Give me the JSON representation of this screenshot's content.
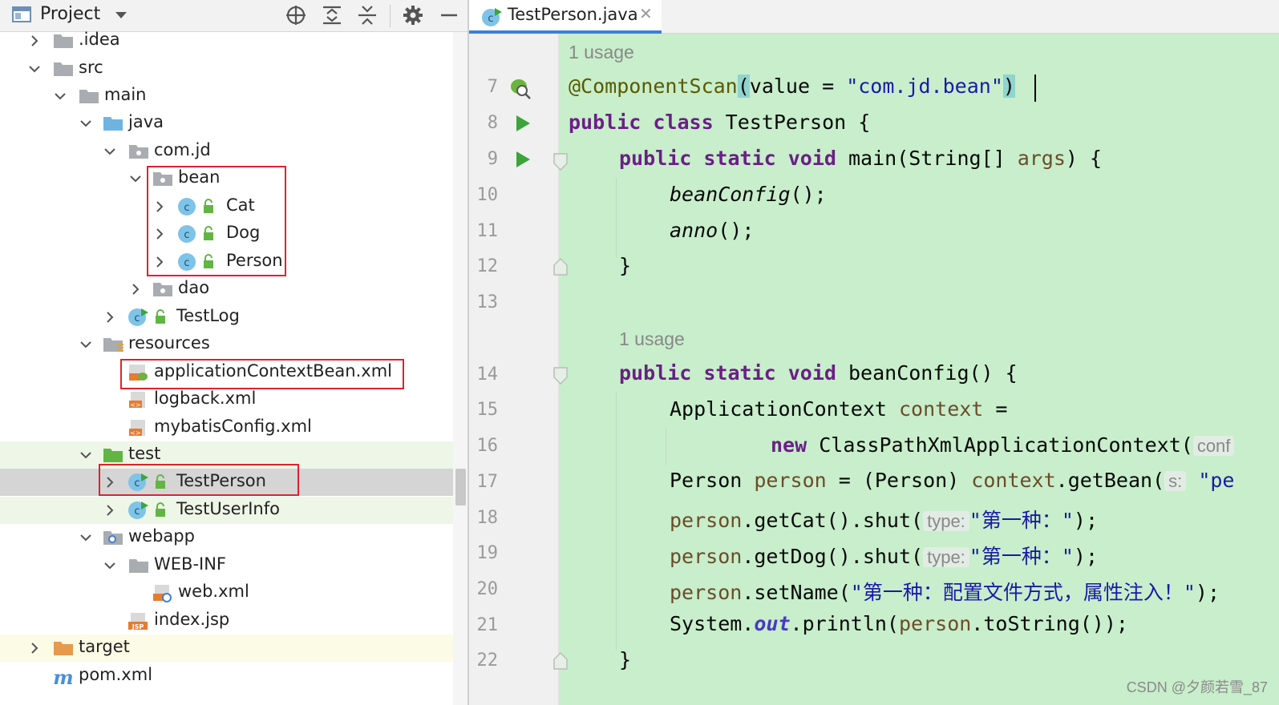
{
  "project_panel": {
    "title": "Project",
    "toolbar_icons": [
      "locate-icon",
      "expand-all-icon",
      "collapse-all-icon",
      "settings-icon",
      "minimize-icon"
    ],
    "tree": [
      {
        "label": ".idea",
        "icon": "folder-icon",
        "expanded": false
      },
      {
        "label": "src",
        "icon": "folder-icon",
        "expanded": true
      },
      {
        "label": "main",
        "icon": "folder-icon",
        "expanded": true
      },
      {
        "label": "java",
        "icon": "source-folder-icon",
        "expanded": true
      },
      {
        "label": "com.jd",
        "icon": "package-icon",
        "expanded": true
      },
      {
        "label": "bean",
        "icon": "package-icon",
        "expanded": true
      },
      {
        "label": "Cat",
        "icon": "class-icon",
        "expanded": false
      },
      {
        "label": "Dog",
        "icon": "class-icon",
        "expanded": false
      },
      {
        "label": "Person",
        "icon": "class-icon",
        "expanded": false
      },
      {
        "label": "dao",
        "icon": "package-icon",
        "expanded": false
      },
      {
        "label": "TestLog",
        "icon": "test-class-icon",
        "expanded": false
      },
      {
        "label": "resources",
        "icon": "resources-folder-icon",
        "expanded": true
      },
      {
        "label": "applicationContextBean.xml",
        "icon": "spring-xml-icon"
      },
      {
        "label": "logback.xml",
        "icon": "xml-file-icon"
      },
      {
        "label": "mybatisConfig.xml",
        "icon": "xml-file-icon"
      },
      {
        "label": "test",
        "icon": "test-folder-icon",
        "expanded": true
      },
      {
        "label": "TestPerson",
        "icon": "test-class-icon",
        "expanded": false,
        "selected": true
      },
      {
        "label": "TestUserInfo",
        "icon": "test-class-icon",
        "expanded": false
      },
      {
        "label": "webapp",
        "icon": "web-folder-icon",
        "expanded": true
      },
      {
        "label": "WEB-INF",
        "icon": "folder-icon",
        "expanded": true
      },
      {
        "label": "web.xml",
        "icon": "web-xml-icon"
      },
      {
        "label": "index.jsp",
        "icon": "jsp-file-icon"
      },
      {
        "label": "target",
        "icon": "excluded-folder-icon",
        "expanded": false
      },
      {
        "label": "pom.xml",
        "icon": "maven-icon"
      }
    ]
  },
  "editor": {
    "tab": {
      "label": "TestPerson.java",
      "close": "✕"
    },
    "usage_hints": [
      "1 usage",
      "1 usage"
    ],
    "line_numbers": [
      "7",
      "8",
      "9",
      "10",
      "11",
      "12",
      "13",
      "14",
      "15",
      "16",
      "17",
      "18",
      "19",
      "20",
      "21",
      "22"
    ],
    "lines": {
      "l7": {
        "ann": "@ComponentScan",
        "p1": "(",
        "attr": "value = ",
        "str": "\"com.jd.bean\"",
        "p2": ")"
      },
      "l8": {
        "kw": "public class ",
        "rest": "TestPerson {"
      },
      "l9": {
        "kw": "public static void ",
        "rest1": "main(String[] ",
        "var": "args",
        "rest2": ") {"
      },
      "l10": {
        "itl": "beanConfig",
        "rest": "();"
      },
      "l11": {
        "itl": "anno",
        "rest": "();"
      },
      "l12": {
        "rest": "}"
      },
      "l14": {
        "kw": "public static void ",
        "rest": "beanConfig() {"
      },
      "l15": {
        "rest": "ApplicationContext ",
        "var": "context",
        "rest2": " ="
      },
      "l16": {
        "kw": "new ",
        "rest": "ClassPathXmlApplicationContext(",
        "ph": "conf"
      },
      "l17": {
        "rest": "Person ",
        "var": "person",
        "rest2": " = (Person) ",
        "var2": "context",
        "rest3": ".getBean(",
        "ph": "s:",
        "str": "\"pe"
      },
      "l18": {
        "var": "person",
        "rest": ".getCat().shut(",
        "ph": "type:",
        "str": "\"第一种：\"",
        "rest2": ");"
      },
      "l19": {
        "var": "person",
        "rest": ".getDog().shut(",
        "ph": "type:",
        "str": "\"第一种：\"",
        "rest2": ");"
      },
      "l20": {
        "var": "person",
        "rest": ".setName(",
        "str": "\"第一种：配置文件方式，属性注入！\"",
        "rest2": ");"
      },
      "l21": {
        "rest": "System.",
        "fld": "out",
        "rest2": ".println(",
        "var": "person",
        "rest3": ".toString());"
      },
      "l22": {
        "rest": "}"
      }
    }
  },
  "watermark": "CSDN @夕颜若雪_87",
  "colors": {
    "editor_bg": "#c8eecb",
    "selection_box": "#e0222c",
    "tab_underline": "#3f7fd6"
  }
}
